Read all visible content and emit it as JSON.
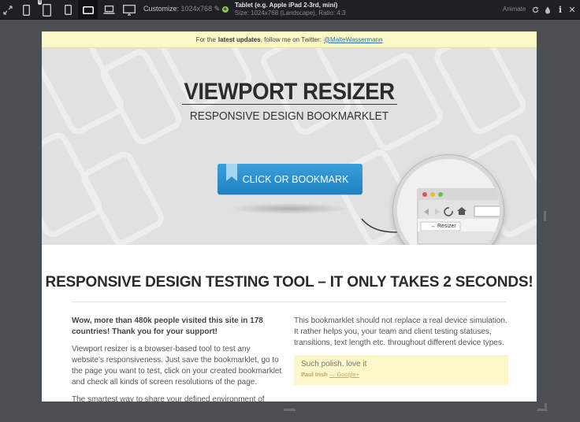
{
  "toolbar": {
    "customize_label": "Customize:",
    "customize_value": "1024x768",
    "device_name": "Tablet (e.g. Apple iPad 2-3rd, mini)",
    "device_size": "Size: 1024x768 (Landscape), Ratio: 4:3",
    "animate_label": "Animate",
    "device_badge": "5",
    "icons": [
      "fullscreen-icon",
      "mobile-portrait-icon",
      "mobile-landscape-icon",
      "tablet-portrait-icon",
      "tablet-landscape-icon",
      "laptop-icon",
      "desktop-icon",
      "edit-icon",
      "add-icon",
      "refresh-icon",
      "drop-icon",
      "info-icon",
      "close-icon"
    ]
  },
  "notice": {
    "prefix": "For the",
    "bold": "latest updates",
    "middle": ", follow me on Twitter:",
    "link": "@MalteWassermann"
  },
  "hero": {
    "title": "VIEWPORT RESIZER",
    "subtitle": "RESPONSIVE DESIGN BOOKMARKLET",
    "cta_label": "CLICK OR BOOKMARK",
    "magnifier_bookmark": "↔ Resizer"
  },
  "content": {
    "headline": "RESPONSIVE DESIGN TESTING TOOL – IT ONLY TAKES 2 SECONDS!",
    "lead": "Wow, more than 480k people visited this site in 178 countries! Thank you for your support!",
    "para1": "Viewport resizer is a browser-based tool to test any website’s responsiveness. Just save the bookmarklet, go to the page you want to test, click on your created bookmarklet and check all kinds of screen resolutions of the page.",
    "para2": "The smartest way to share your defined environment of",
    "right_para": "This bookmarklet should not replace a real device simulation. It rather helps you, your team and client testing statuses, transitions, text length etc. throughout different device types.",
    "quote_text": "Such polish. love it",
    "quote_author": "Paul Irish",
    "quote_source": "— Google+"
  },
  "colors": {
    "toolbar_bg": "#1f2023",
    "canvas_bg": "#4b4e53",
    "notice_bg": "#fbf8c5",
    "cta_blue": "#2b8fd0",
    "quote_bg": "#fcf7c9"
  }
}
